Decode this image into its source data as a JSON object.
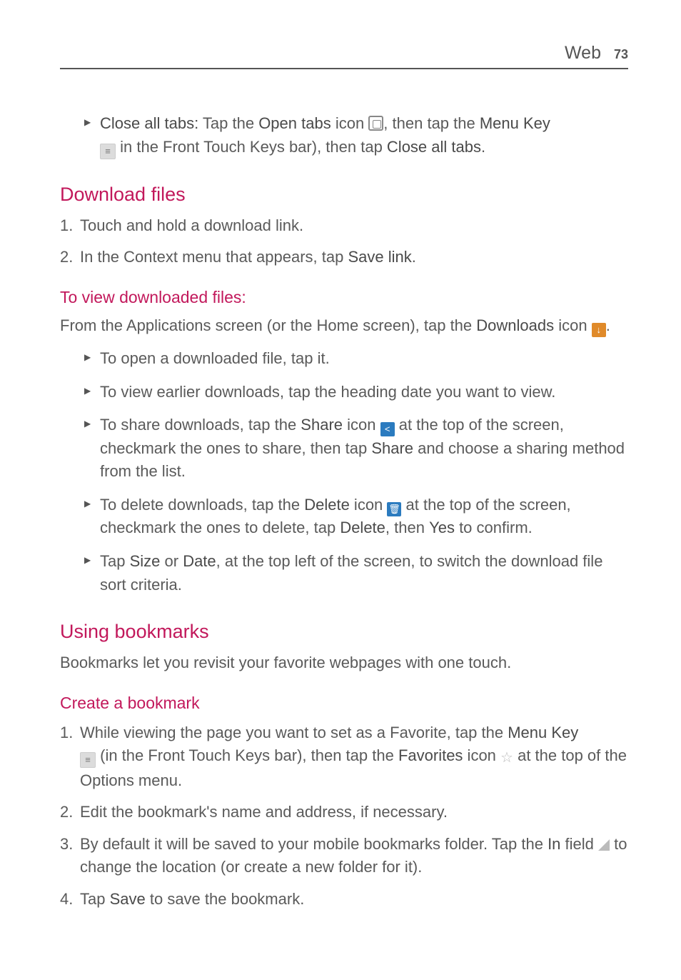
{
  "header": {
    "section": "Web",
    "page_number": "73"
  },
  "top_bullet": {
    "b1": "Close all tabs:",
    "t1": " Tap the ",
    "b2": "Open tabs",
    "t2": " icon ",
    "t3": ", then tap the ",
    "b3": "Menu Key",
    "t4": " in the Front Touch Keys bar), then tap ",
    "b4": "Close all tabs",
    "t5": "."
  },
  "download_files": {
    "heading": "Download files",
    "step1": "Touch and hold a download link.",
    "step2_a": "In the Context menu that appears, tap ",
    "step2_b": "Save link",
    "step2_c": "."
  },
  "view_downloaded": {
    "heading": "To view downloaded files:",
    "intro_a": "From the Applications screen (or the Home screen), tap the ",
    "intro_b": "Downloads",
    "intro_c": " icon ",
    "intro_d": ".",
    "li1": "To open a downloaded file, tap it.",
    "li2": "To view earlier downloads, tap the heading date you want to view.",
    "li3_a": "To share downloads, tap the ",
    "li3_b": "Share",
    "li3_c": " icon ",
    "li3_d": " at the top of the screen, checkmark the ones to share, then tap ",
    "li3_e": "Share",
    "li3_f": " and choose a sharing method from the list.",
    "li4_a": "To delete downloads, tap the ",
    "li4_b": "Delete",
    "li4_c": " icon ",
    "li4_d": " at the top of the screen, checkmark the ones to delete, tap ",
    "li4_e": "Delete",
    "li4_f": ", then ",
    "li4_g": "Yes",
    "li4_h": " to confirm.",
    "li5_a": "Tap ",
    "li5_b": "Size",
    "li5_c": " or ",
    "li5_d": "Date",
    "li5_e": ", at the top left of the screen, to switch the download file sort criteria."
  },
  "bookmarks": {
    "heading": "Using bookmarks",
    "intro": "Bookmarks let you revisit your favorite webpages with one touch.",
    "create_heading": "Create a bookmark",
    "s1_a": "While viewing the page you want to set as a Favorite, tap the ",
    "s1_b": "Menu Key",
    "s1_c": " (in the Front Touch Keys bar), then tap the ",
    "s1_d": "Favorites",
    "s1_e": " icon ",
    "s1_f": " at the top of the Options menu.",
    "s2": "Edit the bookmark's name and address, if necessary.",
    "s3_a": "By default it will be saved to your mobile bookmarks folder. Tap the ",
    "s3_b": "In",
    "s3_c": " field ",
    "s3_d": " to change the location (or create a new folder for it).",
    "s4_a": "Tap ",
    "s4_b": "Save",
    "s4_c": " to save the bookmark."
  }
}
